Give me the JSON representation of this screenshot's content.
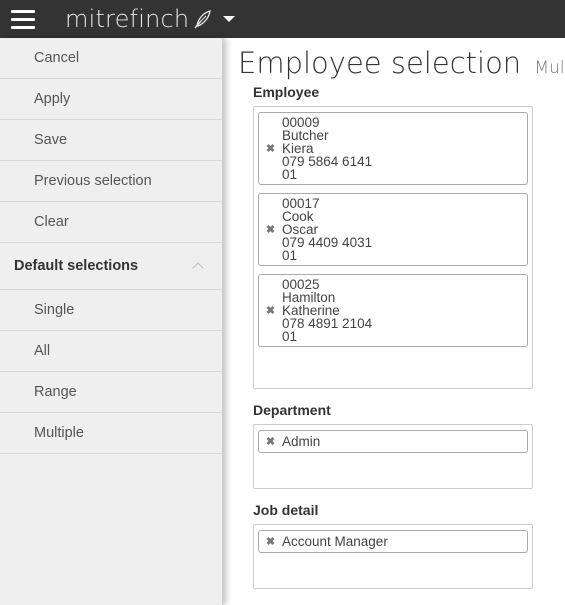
{
  "app": {
    "brand": "mitrefinch"
  },
  "sidebar": {
    "items": [
      {
        "label": "Cancel"
      },
      {
        "label": "Apply"
      },
      {
        "label": "Save"
      },
      {
        "label": "Previous selection"
      },
      {
        "label": "Clear"
      }
    ],
    "default_header": "Default selections",
    "defaults": [
      {
        "label": "Single"
      },
      {
        "label": "All"
      },
      {
        "label": "Range"
      },
      {
        "label": "Multiple"
      }
    ]
  },
  "main": {
    "title": "Employee selection",
    "subtitle": "Multiple",
    "employee": {
      "label": "Employee",
      "chips": [
        {
          "lines": [
            "00009",
            "Butcher",
            "Kiera",
            "079 5864 6141",
            "01"
          ]
        },
        {
          "lines": [
            "00017",
            "Cook",
            "Oscar",
            "079 4409 4031",
            "01"
          ]
        },
        {
          "lines": [
            "00025",
            "Hamilton",
            "Katherine",
            "078 4891 2104",
            "01"
          ]
        }
      ]
    },
    "department": {
      "label": "Department",
      "chips": [
        {
          "lines": [
            "Admin"
          ]
        }
      ]
    },
    "job_detail": {
      "label": "Job detail",
      "chips": [
        {
          "lines": [
            "Account Manager"
          ]
        }
      ]
    },
    "remove_glyph": "✖"
  },
  "colors": {
    "topbar": "#333333",
    "sidebar": "#efefef",
    "main": "#ffffff"
  },
  "icons": [
    "menu-icon",
    "quill-icon",
    "caret-down-icon",
    "chevron-up-icon",
    "remove-icon"
  ]
}
